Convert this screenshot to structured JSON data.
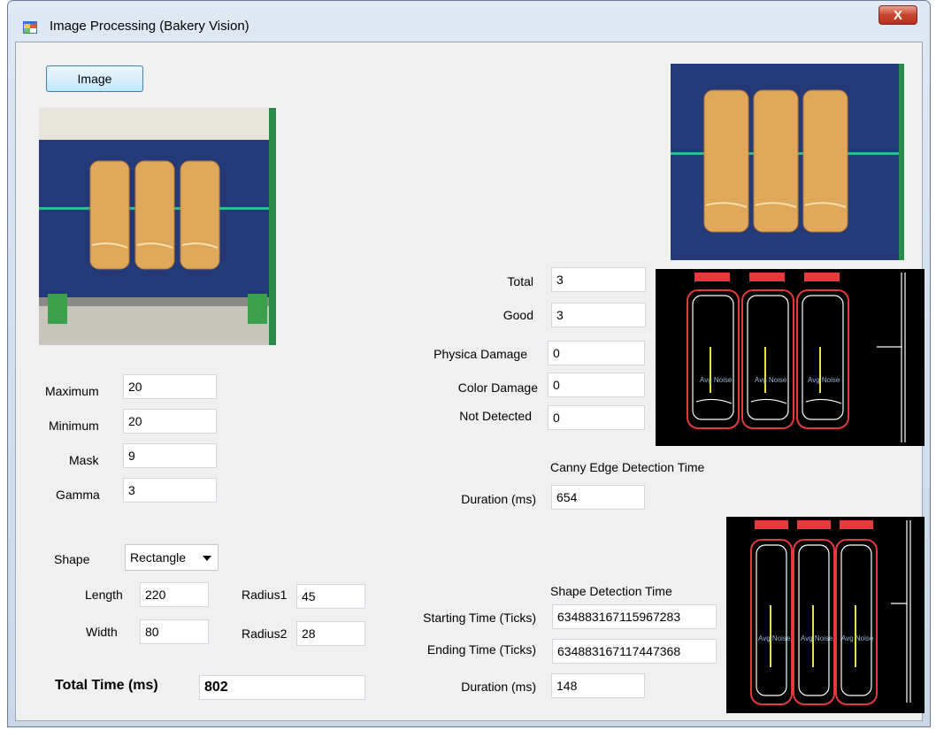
{
  "window": {
    "title": "Image Processing (Bakery Vision)",
    "close_label": "X"
  },
  "image_button": "Image",
  "params": [
    {
      "label": "Maximum",
      "value": "20"
    },
    {
      "label": "Minimum",
      "value": "20"
    },
    {
      "label": "Mask",
      "value": "9"
    },
    {
      "label": "Gamma",
      "value": "3"
    }
  ],
  "shape": {
    "label": "Shape",
    "selected": "Rectangle"
  },
  "dims": {
    "length_label": "Length",
    "length": "220",
    "width_label": "Width",
    "width": "80",
    "radius1_label": "Radius1",
    "radius1": "45",
    "radius2_label": "Radius2",
    "radius2": "28"
  },
  "total_time": {
    "label": "Total Time (ms)",
    "value": "802"
  },
  "counts": {
    "total_label": "Total",
    "total": "3",
    "good_label": "Good",
    "good": "3",
    "physical_label": "Physica Damage",
    "physical": "0",
    "color_label": "Color Damage",
    "color": "0",
    "notdet_label": "Not Detected",
    "notdet": "0"
  },
  "canny": {
    "heading": "Canny Edge Detection Time",
    "duration_label": "Duration (ms)",
    "duration": "654"
  },
  "shape_detect": {
    "heading": "Shape Detection Time",
    "start_label": "Starting Time (Ticks)",
    "start": "634883167115967283",
    "end_label": "Ending Time (Ticks)",
    "end": "634883167117447368",
    "duration_label": "Duration (ms)",
    "duration": "148"
  },
  "overlay": {
    "noise_label": "Avg Noise"
  },
  "colors": {
    "belt": "#243a78",
    "bread": "#e0a85a",
    "edge_red": "#e23b3b",
    "edge_yellow": "#e8e24a"
  }
}
